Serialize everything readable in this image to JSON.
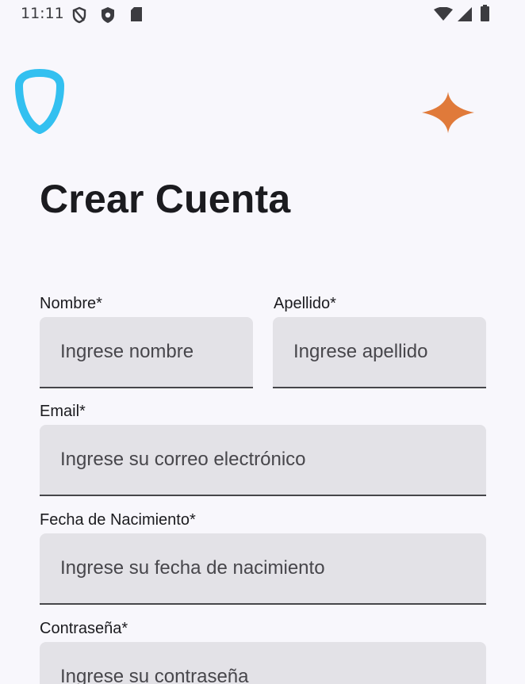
{
  "status_bar": {
    "time": "11:11",
    "icons": [
      "vpn-shield-icon",
      "security-shield-icon",
      "sd-card-icon",
      "wifi-icon",
      "cell-signal-icon",
      "battery-icon"
    ]
  },
  "header": {
    "logo_icon": "shield-logo-icon",
    "sparkle_icon": "sparkle-icon",
    "title": "Crear Cuenta"
  },
  "form": {
    "nombre": {
      "label": "Nombre*",
      "placeholder": "Ingrese nombre",
      "value": ""
    },
    "apellido": {
      "label": "Apellido*",
      "placeholder": "Ingrese apellido",
      "value": ""
    },
    "email": {
      "label": "Email*",
      "placeholder": "Ingrese su correo electrónico",
      "value": ""
    },
    "fecha_nacimiento": {
      "label": "Fecha de Nacimiento*",
      "placeholder": "Ingrese su fecha de nacimiento",
      "value": ""
    },
    "contrasena": {
      "label": "Contraseña*",
      "placeholder": "Ingrese su contraseña",
      "value": ""
    }
  },
  "colors": {
    "background": "#f8f7fc",
    "field_fill": "#e3e2e7",
    "logo_accent": "#33c0f0",
    "sparkle_accent": "#e07a3a",
    "text_primary": "#1b1b1f"
  }
}
